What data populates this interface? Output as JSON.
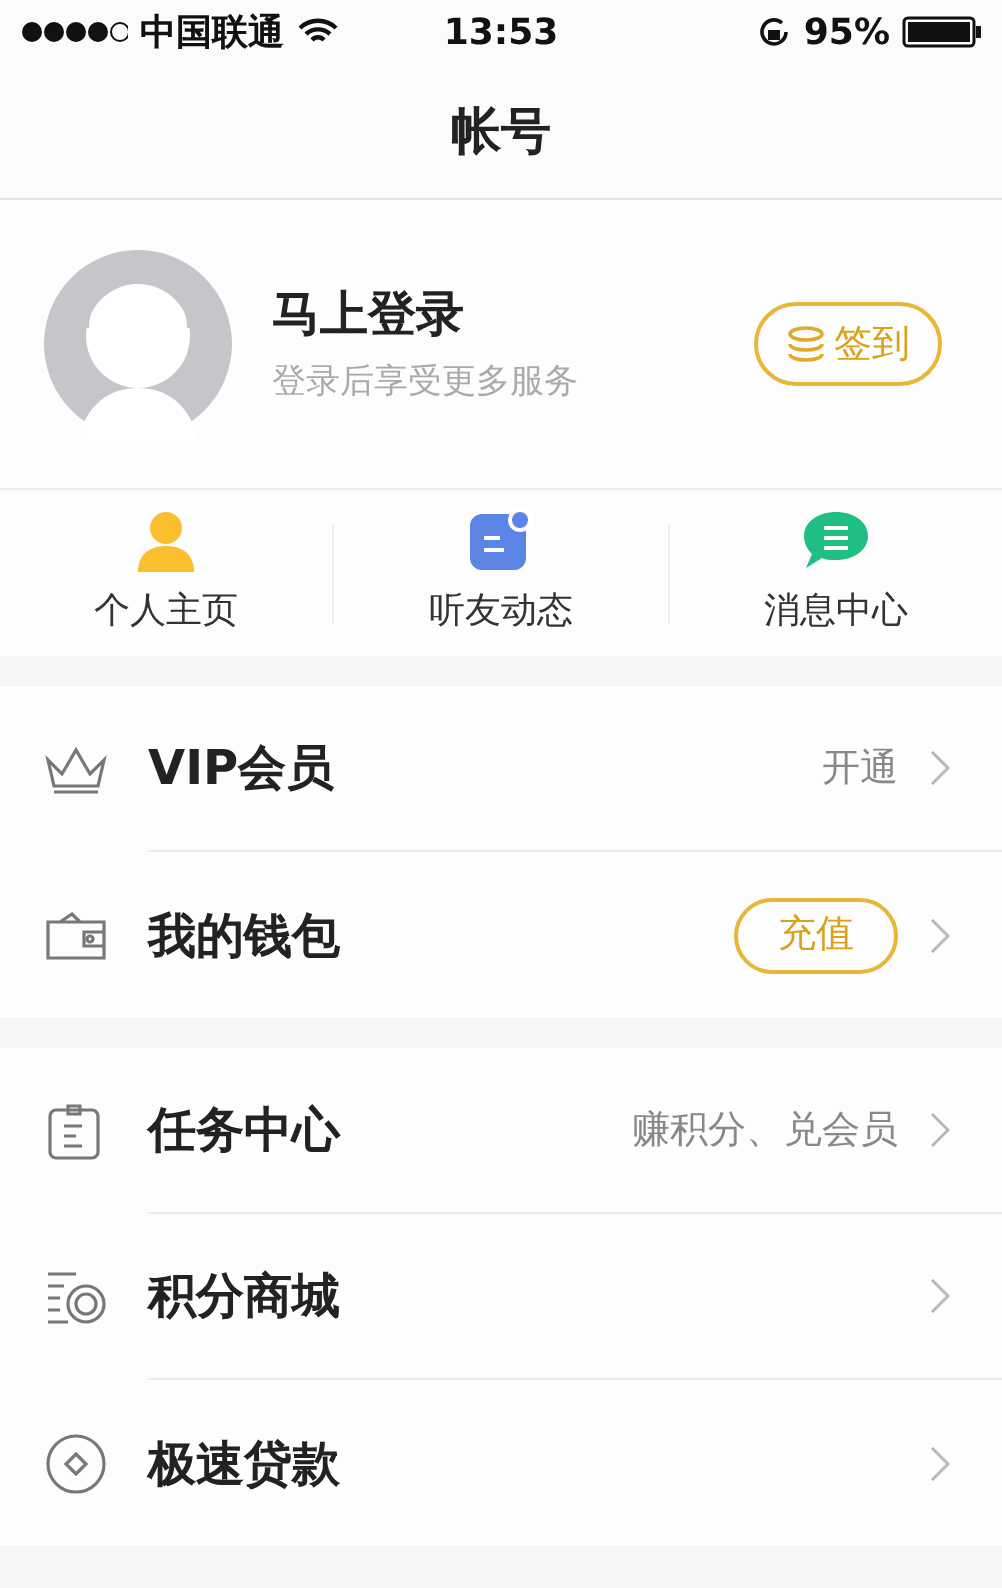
{
  "status_bar": {
    "carrier": "中国联通",
    "time": "13:53",
    "battery": "95%"
  },
  "nav": {
    "title": "帐号"
  },
  "profile": {
    "name": "马上登录",
    "subtitle": "登录后享受更多服务",
    "checkin_button": "签到"
  },
  "shortcuts": [
    {
      "label": "个人主页"
    },
    {
      "label": "听友动态"
    },
    {
      "label": "消息中心"
    }
  ],
  "groups": [
    {
      "items": [
        {
          "label": "VIP会员",
          "kind": "detail",
          "detail": "开通"
        },
        {
          "label": "我的钱包",
          "kind": "button",
          "button": "充值"
        }
      ]
    },
    {
      "items": [
        {
          "label": "任务中心",
          "kind": "detail",
          "detail": "赚积分、兑会员"
        },
        {
          "label": "积分商城",
          "kind": "plain"
        },
        {
          "label": "极速贷款",
          "kind": "plain"
        }
      ]
    }
  ]
}
